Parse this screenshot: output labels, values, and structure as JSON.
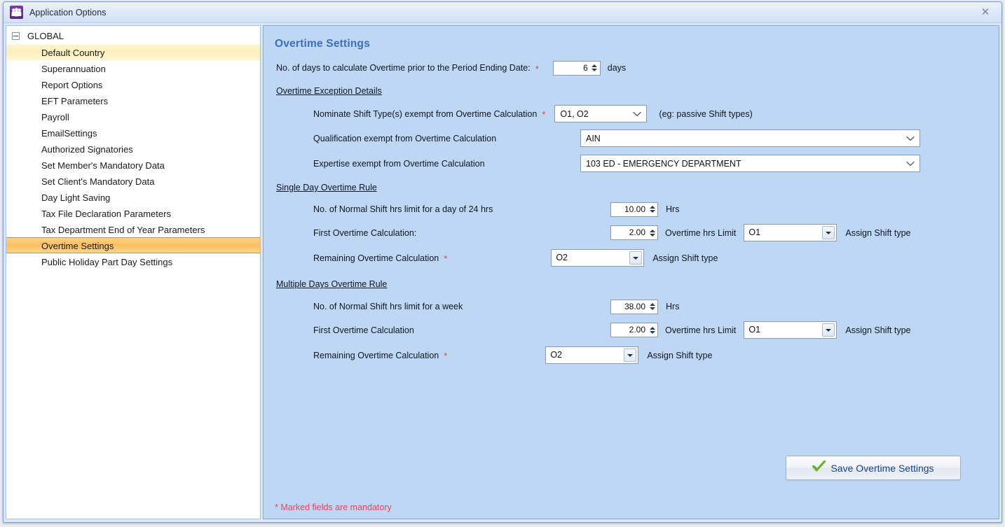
{
  "window": {
    "title": "Application Options",
    "app_icon": "people-icon",
    "close_label": "✕"
  },
  "sidebar": {
    "root": {
      "label": "GLOBAL",
      "expander": "collapse-minus-icon"
    },
    "items": [
      {
        "label": "Default Country",
        "state": "hover"
      },
      {
        "label": "Superannuation",
        "state": "normal"
      },
      {
        "label": "Report Options",
        "state": "normal"
      },
      {
        "label": "EFT Parameters",
        "state": "normal"
      },
      {
        "label": "Payroll",
        "state": "normal"
      },
      {
        "label": "EmailSettings",
        "state": "normal"
      },
      {
        "label": "Authorized Signatories",
        "state": "normal"
      },
      {
        "label": "Set Member's Mandatory Data",
        "state": "normal"
      },
      {
        "label": "Set Client's Mandatory Data",
        "state": "normal"
      },
      {
        "label": "Day Light Saving",
        "state": "normal"
      },
      {
        "label": "Tax File Declaration Parameters",
        "state": "normal"
      },
      {
        "label": "Tax Department End of Year Parameters",
        "state": "normal"
      },
      {
        "label": "Overtime Settings",
        "state": "selected"
      },
      {
        "label": "Public Holiday Part Day Settings",
        "state": "normal"
      }
    ]
  },
  "main": {
    "title": "Overtime Settings",
    "days_row": {
      "label": "No. of days to calculate Overtime prior to the Period Ending Date:",
      "value": "6",
      "unit": "days"
    },
    "exception_heading": "Overtime Exception Details",
    "nominate_shift": {
      "label": "Nominate Shift Type(s) exempt from Overtime Calculation",
      "value": "O1, O2",
      "hint": "(eg: passive Shift types)"
    },
    "qualification": {
      "label": "Qualification exempt from Overtime Calculation",
      "value": "AIN"
    },
    "expertise": {
      "label": "Expertise exempt from Overtime Calculation",
      "value": "103 ED - EMERGENCY DEPARTMENT"
    },
    "single_day": {
      "heading": "Single Day Overtime Rule",
      "normal_hrs": {
        "label": "No. of Normal Shift hrs limit for a day of 24 hrs",
        "value": "10.00",
        "unit": "Hrs"
      },
      "first_ot": {
        "label": "First Overtime Calculation:",
        "value": "2.00",
        "mid_label": "Overtime hrs Limit",
        "shift_type": "O1",
        "trailing_label": "Assign Shift type"
      },
      "remaining_ot": {
        "label": "Remaining Overtime Calculation",
        "shift_type": "O2",
        "trailing_label": "Assign Shift type"
      }
    },
    "multiple_days": {
      "heading": "Multiple Days Overtime Rule",
      "normal_hrs": {
        "label": "No. of Normal Shift hrs limit for a week",
        "value": "38.00",
        "unit": "Hrs"
      },
      "first_ot": {
        "label": "First Overtime Calculation",
        "value": "2.00",
        "mid_label": "Overtime hrs Limit",
        "shift_type": "O1",
        "trailing_label": "Assign Shift type"
      },
      "remaining_ot": {
        "label": "Remaining Overtime Calculation",
        "shift_type": "O2",
        "trailing_label": "Assign Shift type"
      }
    },
    "save_button": {
      "label": "Save Overtime Settings",
      "icon": "green-check-icon"
    },
    "footer_note": "* Marked fields are mandatory",
    "required_marker": "*"
  },
  "colors": {
    "content_bg": "#bdd7f5",
    "title_accent": "#3c6fb5",
    "selected_item": "#fcc062",
    "required_red": "#e8443a",
    "footer_red": "#f0425a"
  }
}
